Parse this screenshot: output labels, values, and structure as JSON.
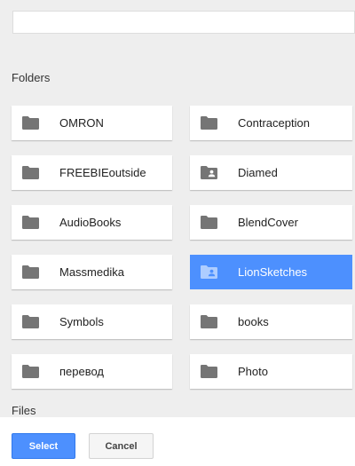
{
  "search": {
    "value": "",
    "placeholder": ""
  },
  "sections": {
    "folders_label": "Folders",
    "files_label": "Files"
  },
  "folders": [
    {
      "name": "OMRON",
      "icon": "folder-icon",
      "selected": false
    },
    {
      "name": "Contraception",
      "icon": "folder-icon",
      "selected": false
    },
    {
      "name": "FREEBIEoutside",
      "icon": "folder-icon",
      "selected": false
    },
    {
      "name": "Diamed",
      "icon": "shared-folder-icon",
      "selected": false
    },
    {
      "name": "AudioBooks",
      "icon": "folder-icon",
      "selected": false
    },
    {
      "name": "BlendCover",
      "icon": "folder-icon",
      "selected": false
    },
    {
      "name": "Massmedika",
      "icon": "folder-icon",
      "selected": false
    },
    {
      "name": "LionSketches",
      "icon": "shared-folder-icon",
      "selected": true
    },
    {
      "name": "Symbols",
      "icon": "folder-icon",
      "selected": false
    },
    {
      "name": "books",
      "icon": "folder-icon",
      "selected": false
    },
    {
      "name": "перевод",
      "icon": "folder-icon",
      "selected": false
    },
    {
      "name": "Photo",
      "icon": "folder-icon",
      "selected": false
    }
  ],
  "footer": {
    "select_label": "Select",
    "cancel_label": "Cancel"
  },
  "colors": {
    "accent": "#4d90fe",
    "icon_gray": "#757575",
    "background": "#eeeeee"
  }
}
